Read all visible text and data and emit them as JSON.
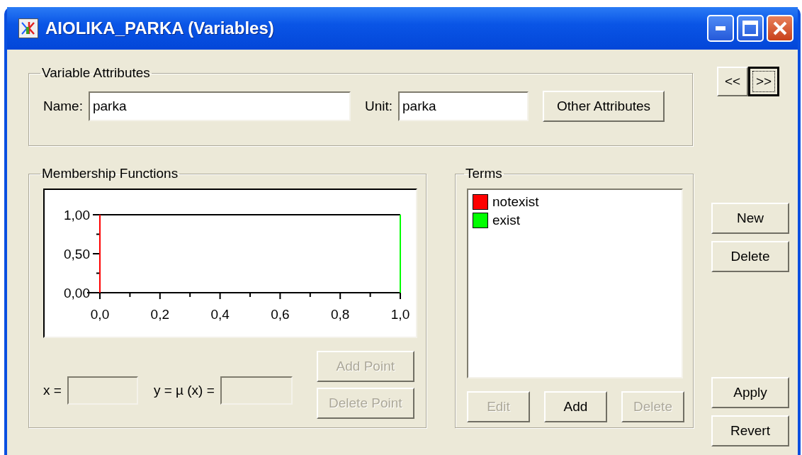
{
  "window": {
    "title": "AIOLIKA_PARKA (Variables)"
  },
  "variable_attributes": {
    "label": "Variable Attributes",
    "name_label": "Name:",
    "name_value": "parka",
    "unit_label": "Unit:",
    "unit_value": "parka",
    "other_button": "Other Attributes"
  },
  "nav_buttons": [
    {
      "label": "<<",
      "default": false
    },
    {
      "label": ">>",
      "default": true
    }
  ],
  "membership": {
    "label": "Membership Functions",
    "chart_data": {
      "type": "bar",
      "x": [
        0,
        1
      ],
      "xlim": [
        0,
        1
      ],
      "ylim": [
        0,
        1
      ],
      "xticks": [
        {
          "value": 0,
          "label": "0,0"
        },
        {
          "value": 0.2,
          "label": "0,2"
        },
        {
          "value": 0.4,
          "label": "0,4"
        },
        {
          "value": 0.6,
          "label": "0,6"
        },
        {
          "value": 0.8,
          "label": "0,8"
        },
        {
          "value": 1,
          "label": "1,0"
        }
      ],
      "yticks": [
        {
          "value": 0,
          "label": "0,00"
        },
        {
          "value": 0.5,
          "label": "0,50"
        },
        {
          "value": 1,
          "label": "1,00"
        }
      ],
      "series": [
        {
          "color": "#ff0000",
          "values": [
            1,
            null
          ]
        },
        {
          "color": "#00ff00",
          "values": [
            null,
            1
          ]
        }
      ]
    },
    "x_label": "x =",
    "y_label": "y = µ (x) =",
    "x_field": {
      "disabled": true
    },
    "y_field": {
      "disabled": true
    },
    "buttons": [
      {
        "label": "Add Point",
        "disabled": true
      },
      {
        "label": "Delete Point",
        "disabled": true
      }
    ]
  },
  "terms": {
    "label": "Terms",
    "items": [
      {
        "label": "notexist",
        "color": "#ff0000"
      },
      {
        "label": "exist",
        "color": "#00ff00"
      }
    ],
    "buttons": [
      {
        "label": "Edit",
        "disabled": true
      },
      {
        "label": "Add",
        "disabled": false
      },
      {
        "label": "Delete",
        "disabled": true
      }
    ]
  },
  "side_buttons": [
    {
      "label": "New"
    },
    {
      "label": "Delete"
    },
    {
      "label": "Apply"
    },
    {
      "label": "Revert"
    }
  ]
}
